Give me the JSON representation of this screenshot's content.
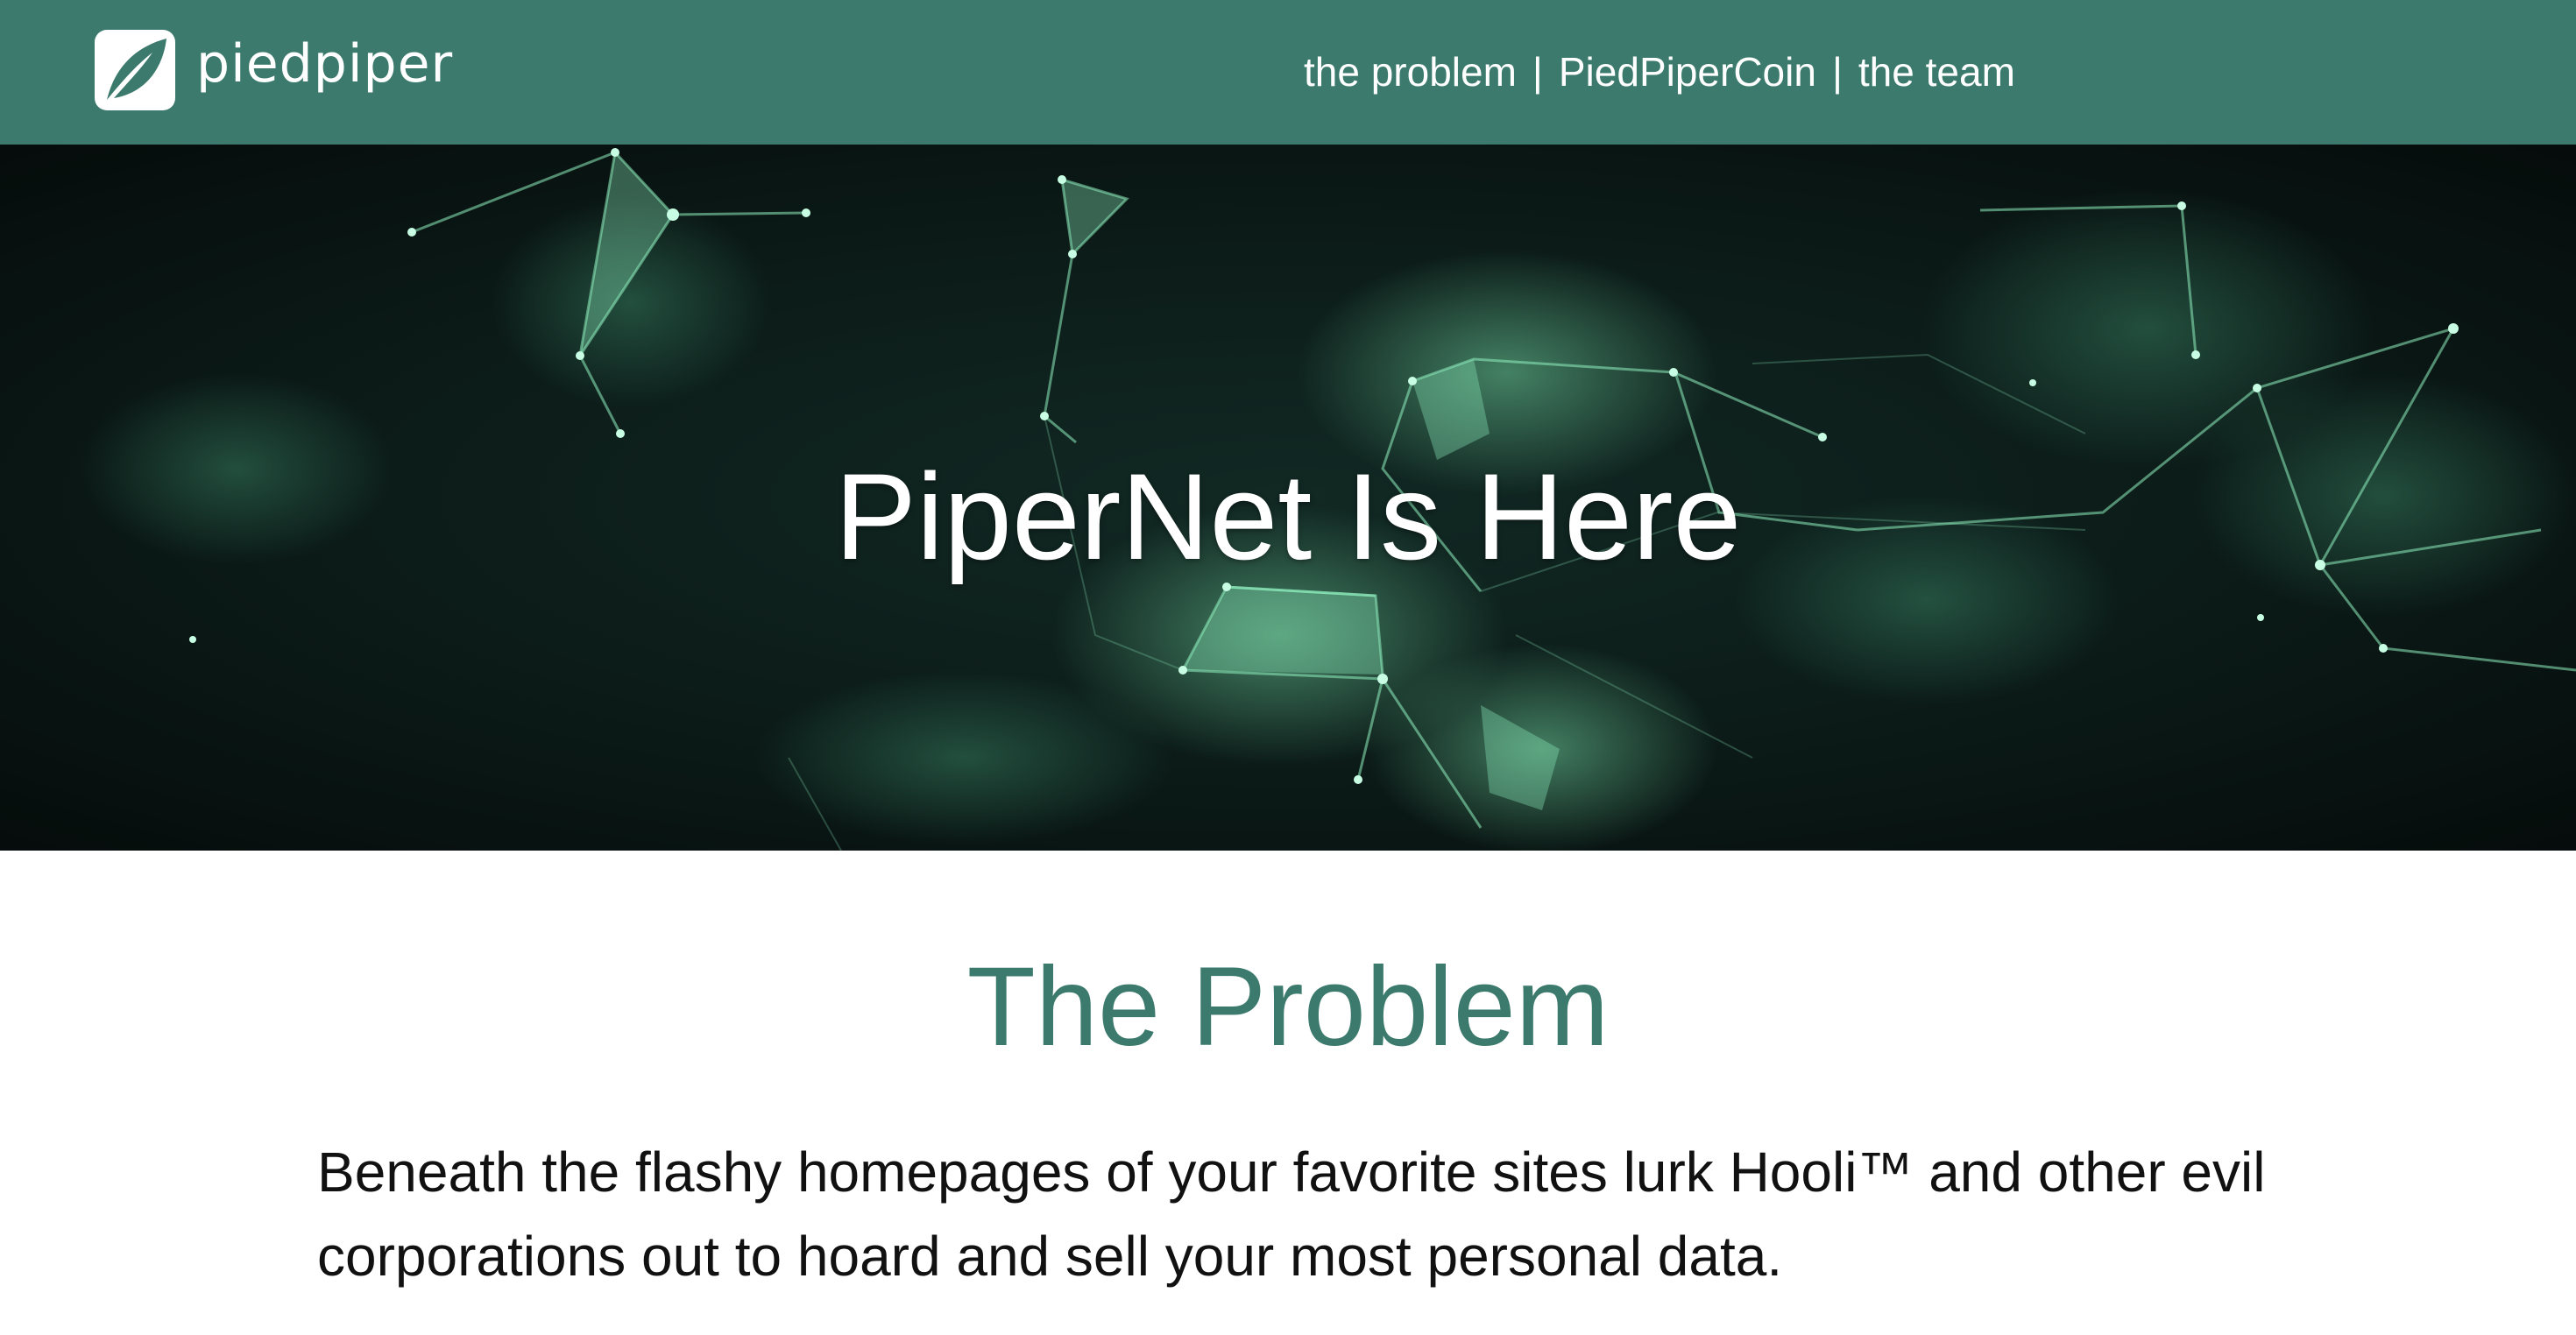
{
  "header": {
    "logo_text": "piedpiper",
    "nav": [
      {
        "label": "the problem"
      },
      {
        "label": "PiedPiperCoin"
      },
      {
        "label": "the team"
      }
    ],
    "separator": "|"
  },
  "hero": {
    "title": "PiperNet Is Here"
  },
  "problem": {
    "heading": "The Problem",
    "body": "Beneath the flashy homepages of your favorite sites lurk Hooli™ and other evil corporations out to hoard and sell your most personal data."
  },
  "colors": {
    "brand": "#3b7a6c",
    "hero_bg": "#0a1513",
    "network_glow": "#7fe0b0"
  },
  "icons": {
    "logo": "leaf-logo-icon"
  }
}
